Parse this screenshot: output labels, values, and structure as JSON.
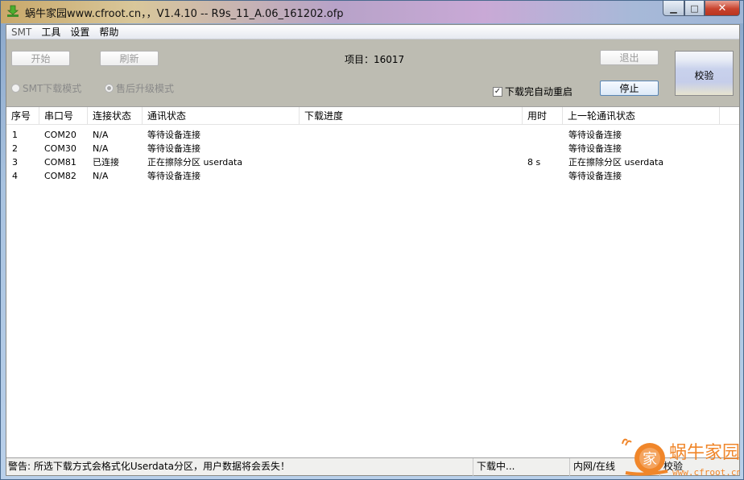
{
  "window": {
    "title": "蜗牛家园www.cfroot.cn，，V1.4.10 -- R9s_11_A.06_161202.ofp",
    "minimize_glyph": "▁",
    "maximize_glyph": "□",
    "close_glyph": "✕"
  },
  "menu": {
    "items": [
      "SMT",
      "工具",
      "设置",
      "帮助"
    ]
  },
  "toolbar": {
    "start_label": "开始",
    "refresh_label": "刷新",
    "project_label": "项目：16017",
    "exit_label": "退出",
    "check_label": "校验",
    "stop_label": "停止",
    "mode_smt_label": "SMT下载模式",
    "mode_aftersale_label": "售后升级模式",
    "auto_restart_label": "下载完自动重启",
    "auto_restart_checked": true,
    "checkbox_glyph": "✓"
  },
  "table": {
    "columns": [
      "序号",
      "串口号",
      "连接状态",
      "通讯状态",
      "下载进度",
      "用时",
      "上一轮通讯状态"
    ],
    "rows": [
      [
        "1",
        "COM20",
        "N/A",
        "等待设备连接",
        "",
        "",
        "等待设备连接"
      ],
      [
        "2",
        "COM30",
        "N/A",
        "等待设备连接",
        "",
        "",
        "等待设备连接"
      ],
      [
        "3",
        "COM81",
        "已连接",
        "正在擦除分区 userdata",
        "",
        "8 s",
        "正在擦除分区 userdata"
      ],
      [
        "4",
        "COM82",
        "N/A",
        "等待设备连接",
        "",
        "",
        "等待设备连接"
      ]
    ]
  },
  "statusbar": {
    "warning": "警告: 所选下载方式会格式化Userdata分区，用户数据将会丢失！",
    "download": "下载中...",
    "network": "内网/在线",
    "check": "校验"
  },
  "watermark": {
    "brand": "蜗牛家园",
    "url": "www.cfroot.cn",
    "badge_char": "家"
  },
  "colors": {
    "titlebar_accent": "#c9a9d6",
    "close_button": "#c8432e",
    "client_bg": "#bdbcb2",
    "watermark_orange": "#f0862a"
  }
}
